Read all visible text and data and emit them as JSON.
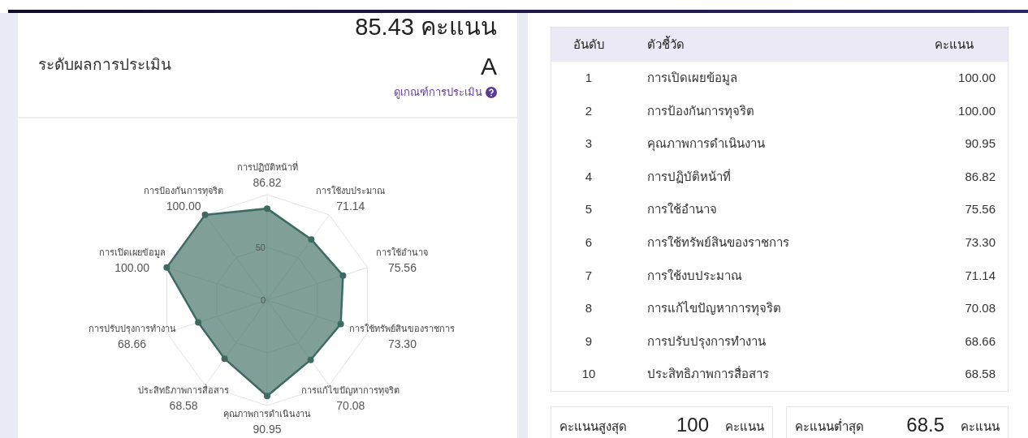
{
  "summary": {
    "score": "85.43 คะแนน",
    "grade_label": "ระดับผลการประเมิน",
    "grade": "A",
    "criteria_link": "ดูเกณฑ์การประเมิน"
  },
  "radar": {
    "ticks": [
      "50",
      "0"
    ],
    "axes": [
      {
        "label": "การปฏิบัติหน้าที่",
        "value": "86.82"
      },
      {
        "label": "การป้องกันการทุจริต",
        "value": "100.00"
      },
      {
        "label": "การใช้งบประมาณ",
        "value": "71.14"
      },
      {
        "label": "การเปิดเผยข้อมูล",
        "value": "100.00"
      },
      {
        "label": "การใช้อำนาจ",
        "value": "75.56"
      },
      {
        "label": "การปรับปรุงการทำงาน",
        "value": "68.66"
      },
      {
        "label": "การใช้ทรัพย์สินของราชการ",
        "value": "73.30"
      },
      {
        "label": "ประสิทธิภาพการสื่อสาร",
        "value": "68.58"
      },
      {
        "label": "การแก้ไขปัญหาการทุจริต",
        "value": "70.08"
      },
      {
        "label": "คุณภาพการดำเนินงาน",
        "value": "90.95"
      }
    ]
  },
  "table": {
    "columns": [
      "อันดับ",
      "ตัวชี้วัด",
      "คะแนน"
    ],
    "rows": [
      [
        "1",
        "การเปิดเผยข้อมูล",
        "100.00"
      ],
      [
        "2",
        "การป้องกันการทุจริต",
        "100.00"
      ],
      [
        "3",
        "คุณภาพการดำเนินงาน",
        "90.95"
      ],
      [
        "4",
        "การปฏิบัติหน้าที่",
        "86.82"
      ],
      [
        "5",
        "การใช้อำนาจ",
        "75.56"
      ],
      [
        "6",
        "การใช้ทรัพย์สินของราชการ",
        "73.30"
      ],
      [
        "7",
        "การใช้งบประมาณ",
        "71.14"
      ],
      [
        "8",
        "การแก้ไขปัญหาการทุจริต",
        "70.08"
      ],
      [
        "9",
        "การปรับปรุงการทำงาน",
        "68.66"
      ],
      [
        "10",
        "ประสิทธิภาพการสื่อสาร",
        "68.58"
      ]
    ]
  },
  "stat_cards": [
    {
      "label": "คะแนนสูงสุด",
      "value": "100",
      "unit": "คะแนน"
    },
    {
      "label": "คะแนนต่ำสุด",
      "value": "68.5",
      "unit": "คะแนน"
    }
  ]
}
